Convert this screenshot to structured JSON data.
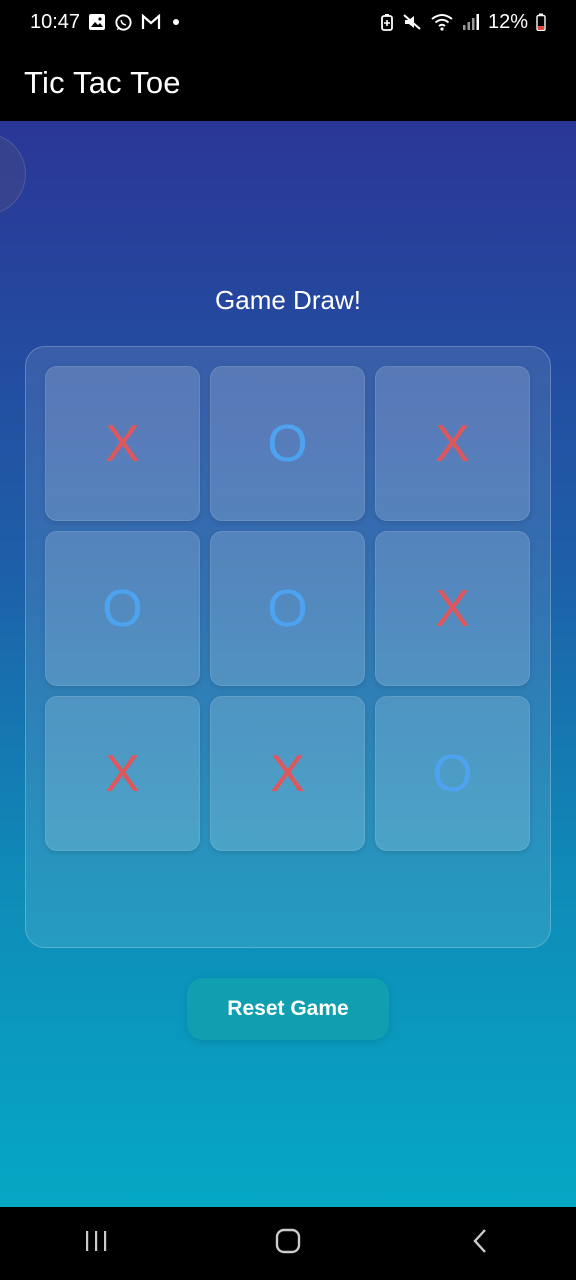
{
  "status_bar": {
    "time": "10:47",
    "battery": "12%",
    "left_icons": [
      "gallery-icon",
      "whatsapp-icon",
      "gmail-icon",
      "notification-dot-icon"
    ],
    "right_icons": [
      "battery-saver-icon",
      "mute-icon",
      "wifi-icon",
      "signal-icon",
      "battery-icon"
    ]
  },
  "app_bar": {
    "title": "Tic Tac Toe"
  },
  "game": {
    "status": "Game Draw!",
    "board": [
      [
        "X",
        "O",
        "X"
      ],
      [
        "O",
        "O",
        "X"
      ],
      [
        "X",
        "X",
        "O"
      ]
    ],
    "colors": {
      "x": "#e0575b",
      "o": "#4ea3f0"
    },
    "reset_label": "Reset Game"
  },
  "nav_bar": {
    "buttons": [
      "recents-icon",
      "home-icon",
      "back-icon"
    ]
  }
}
